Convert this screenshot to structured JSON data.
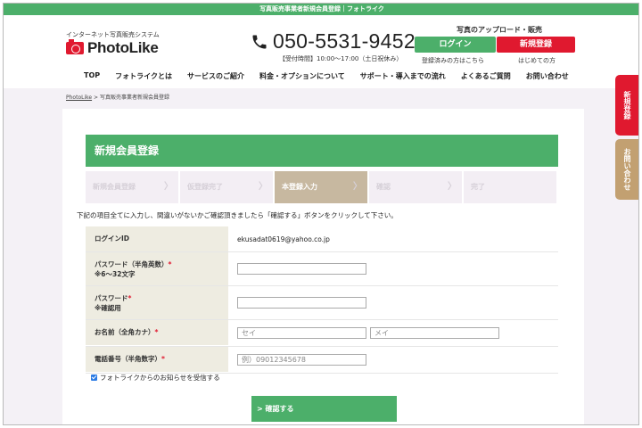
{
  "topbar": {
    "text": "写真販売事業者新規会員登録｜フォトライク"
  },
  "header": {
    "tagline": "インターネット写真販売システム",
    "logo_text": "PhotoLike",
    "phone": "050-5531-9452",
    "hours": "【受付時間】10:00～17:00（土日祝休み）",
    "upload_label": "写真のアップロード・販売",
    "login_button": "ログイン",
    "register_button": "新規登録",
    "login_sub": "登録済みの方はこちら",
    "register_sub": "はじめての方"
  },
  "nav": {
    "items": [
      {
        "label": "TOP"
      },
      {
        "label": "フォトライクとは"
      },
      {
        "label": "サービスのご紹介"
      },
      {
        "label": "料金・オプションについて"
      },
      {
        "label": "サポート・導入までの流れ"
      },
      {
        "label": "よくあるご質問"
      },
      {
        "label": "お問い合わせ"
      }
    ]
  },
  "side_tabs": {
    "register": "新規登録",
    "contact": "お問い合わせ"
  },
  "breadcrumb": {
    "home": "PhotoLike",
    "separator": ">",
    "current": "写真販売事業者新規会員登録"
  },
  "page": {
    "title": "新規会員登録",
    "steps": [
      {
        "label": "新規会員登録",
        "arrow": "〉"
      },
      {
        "label": "仮登録完了",
        "arrow": "〉"
      },
      {
        "label": "本登録入力",
        "arrow": "〉"
      },
      {
        "label": "確認",
        "arrow": "〉"
      },
      {
        "label": "完了",
        "arrow": ""
      }
    ],
    "active_step_index": 2,
    "instruction": "下記の項目全てに入力し、間違いがないかご確認頂きましたら「確認する」ボタンをクリックして下さい。"
  },
  "form": {
    "login_id_label": "ログインID",
    "login_id_value": "ekusadat0619@yahoo.co.jp",
    "password_label": "パスワード（半角英数）",
    "password_note": "※6～32文字",
    "password_confirm_label": "パスワード",
    "password_confirm_note": "※確認用",
    "name_label": "お名前（全角カナ）",
    "name_sei_placeholder": "セイ",
    "name_mei_placeholder": "メイ",
    "phone_label": "電話番号（半角数字）",
    "phone_placeholder": "例）09012345678",
    "required_mark": "*",
    "newsletter_label": "フォトライクからのお知らせを受信する",
    "newsletter_checked": true,
    "submit_label": "> 確認する"
  },
  "colors": {
    "green": "#4caf6a",
    "red": "#e0192f",
    "tan": "#c2a071",
    "active_step": "#c7b8a0"
  }
}
